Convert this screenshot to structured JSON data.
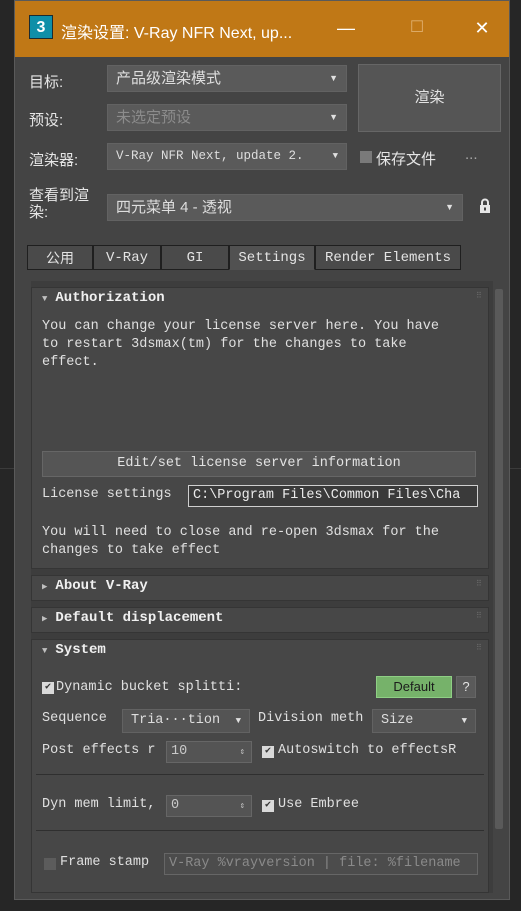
{
  "window": {
    "app_icon": "3",
    "title": "渲染设置: V-Ray NFR Next, up...",
    "minimize": "—",
    "maximize": "☐",
    "close": "✕"
  },
  "top": {
    "target_label": "目标:",
    "target_value": "产品级渲染模式",
    "preset_label": "预设:",
    "preset_value": "未选定预设",
    "renderer_label": "渲染器:",
    "renderer_value": "V-Ray NFR Next, update 2.",
    "render_button": "渲染",
    "save_file": "保存文件",
    "more": "...",
    "view_label_line1": "查看到渲",
    "view_label_line2": "染:",
    "view_value": "四元菜单 4 - 透视",
    "lock_icon": "lock-icon"
  },
  "tabs": [
    "公用",
    "V-Ray",
    "GI",
    "Settings",
    "Render Elements"
  ],
  "active_tab": "Settings",
  "authorization": {
    "header": "Authorization",
    "text_lines": [
      "You can change your license server here. You have",
      "to restart 3dsmax(tm) for the changes to take",
      "effect."
    ],
    "button": "Edit/set license server information",
    "license_label": "License settings",
    "license_value": "C:\\Program Files\\Common Files\\Cha",
    "note_lines": [
      "You will need to close and re-open 3dsmax for the",
      "changes to take effect"
    ]
  },
  "about": {
    "header": "About V-Ray"
  },
  "displacement": {
    "header": "Default displacement"
  },
  "system": {
    "header": "System",
    "dynamic_bucket": "Dynamic bucket splitti:",
    "default_button": "Default",
    "help_button": "?",
    "sequence_label": "Sequence",
    "sequence_value": "Tria···tion",
    "division_label": "Division meth",
    "division_value": "Size",
    "post_effects_label": "Post effects r",
    "post_effects_value": "10",
    "autoswitch": "Autoswitch to effectsR",
    "dyn_mem_label": "Dyn mem limit,",
    "dyn_mem_value": "0",
    "use_embree": "Use Embree",
    "frame_stamp": "Frame stamp",
    "frame_stamp_value": "V-Ray %vrayversion | file: %filename"
  },
  "colors": {
    "titlebar": "#c07816",
    "accent_button": "#76b26a"
  }
}
